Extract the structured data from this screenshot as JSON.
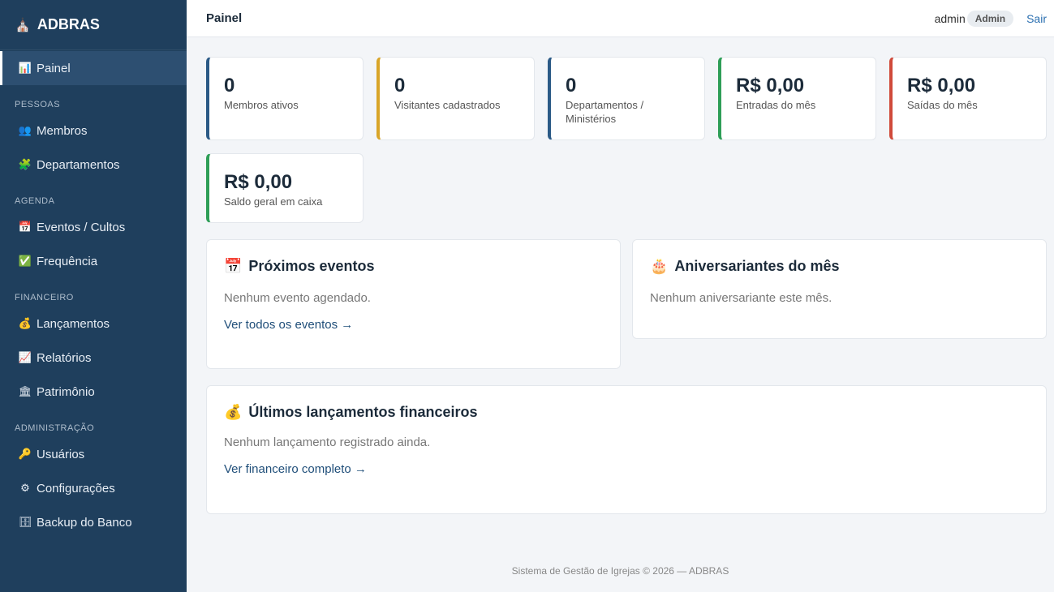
{
  "sidebar": {
    "brand": "ADBRAS",
    "brand_icon": "church-icon",
    "items": {
      "painel": "Painel",
      "membros": "Membros",
      "departamentos": "Departamentos",
      "eventos": "Eventos / Cultos",
      "frequencia": "Frequência",
      "lancamentos": "Lançamentos",
      "relatorios": "Relatórios",
      "patrimonio": "Patrimônio",
      "usuarios": "Usuários",
      "configuracoes": "Configurações",
      "backup": "Backup do Banco"
    },
    "sections": {
      "pessoas": "PESSOAS",
      "agenda": "AGENDA",
      "financeiro": "FINANCEIRO",
      "administracao": "ADMINISTRAÇÃO"
    }
  },
  "header": {
    "title": "Painel",
    "user": "admin",
    "role_badge": "Admin",
    "logout": "Sair"
  },
  "stats": [
    {
      "value": "0",
      "label": "Membros ativos",
      "color": "#2b5a86"
    },
    {
      "value": "0",
      "label": "Visitantes cadastrados",
      "color": "#d9a528"
    },
    {
      "value": "0",
      "label": "Departamentos / Ministérios",
      "color": "#2b5a86"
    },
    {
      "value": "R$ 0,00",
      "label": "Entradas do mês",
      "color": "#2e9e57"
    },
    {
      "value": "R$ 0,00",
      "label": "Saídas do mês",
      "color": "#d04a3a"
    },
    {
      "value": "R$ 0,00",
      "label": "Saldo geral em caixa",
      "color": "#2e9e57"
    }
  ],
  "cards": {
    "eventos": {
      "title": "Próximos eventos",
      "empty": "Nenhum evento agendado.",
      "link": "Ver todos os eventos →"
    },
    "aniversariantes": {
      "title": "Aniversariantes do mês",
      "empty": "Nenhum aniversariante este mês."
    },
    "financeiro": {
      "title": "Últimos lançamentos financeiros",
      "empty": "Nenhum lançamento registrado ainda.",
      "link": "Ver financeiro completo →"
    }
  },
  "footer": "Sistema de Gestão de Igrejas © 2026 — ADBRAS"
}
